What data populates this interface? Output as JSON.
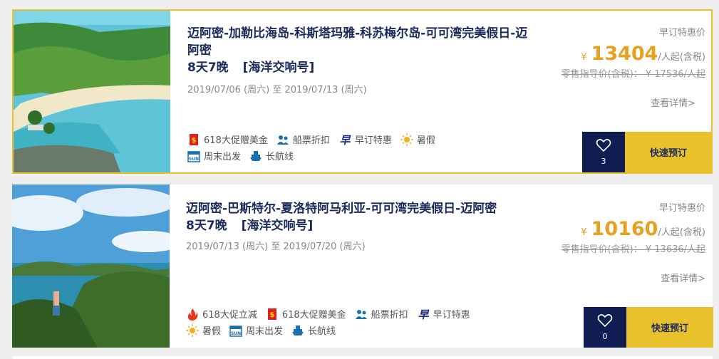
{
  "cards": [
    {
      "title": "迈阿密-加勒比海岛-科斯塔玛雅-科苏梅尔岛-可可湾完美假日-迈阿密",
      "duration": "8天7晚",
      "ship": "[海洋交响号]",
      "dates": "2019/07/06 (周六) 至 2019/07/13 (周六)",
      "price_label": "早订特惠价",
      "currency": "¥",
      "price": "13404",
      "price_unit": "/人起(含税)",
      "orig_price": "零售指导价(含税)： ¥ 17536/人起",
      "details": "查看详情>",
      "fav_count": "3",
      "book": "快速预订",
      "tags_row1": [
        "618大促赠美金",
        "船票折扣",
        "早订特惠",
        "暑假"
      ],
      "tags_row2": [
        "周末出发",
        "长航线"
      ]
    },
    {
      "title": "迈阿密-巴斯特尔-夏洛特阿马利亚-可可湾完美假日-迈阿密",
      "duration": "8天7晚",
      "ship": "[海洋交响号]",
      "dates": "2019/07/13 (周六) 至 2019/07/20 (周六)",
      "price_label": "早订特惠价",
      "currency": "¥",
      "price": "10160",
      "price_unit": "/人起(含税)",
      "orig_price": "零售指导价(含税)： ¥ 13636/人起",
      "details": "查看详情>",
      "fav_count": "0",
      "book": "快速预订",
      "tags_row1": [
        "618大促立减",
        "618大促赠美金",
        "船票折扣",
        "早订特惠"
      ],
      "tags_row2": [
        "暑假",
        "周末出发",
        "长航线"
      ]
    }
  ],
  "colors": {
    "navy": "#0f1d52",
    "gold": "#e8c12d",
    "price": "#e8a020"
  }
}
